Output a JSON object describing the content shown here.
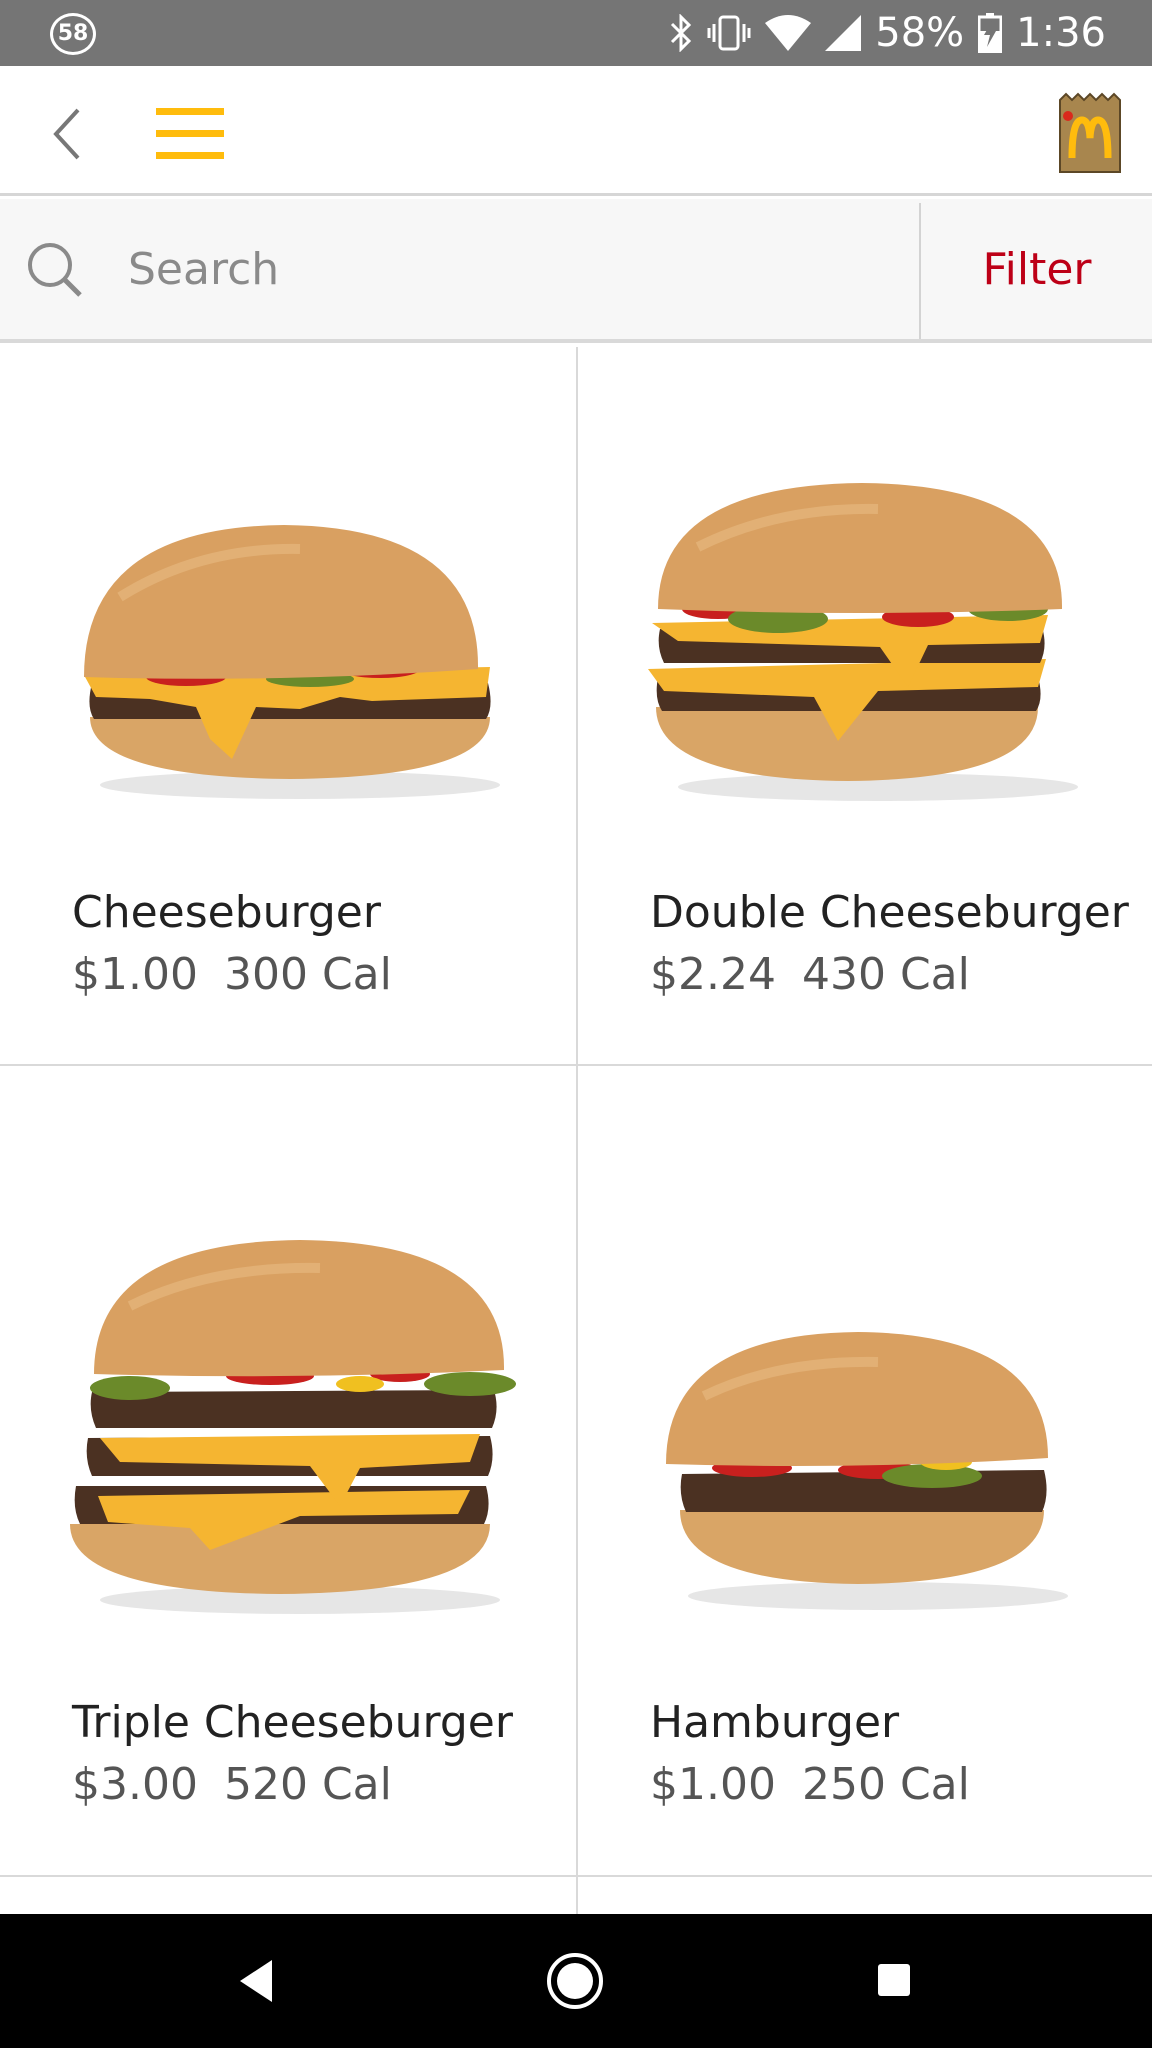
{
  "status_bar": {
    "notification_count": "58",
    "battery_percent": "58%",
    "time": "1:36",
    "icons": [
      "bluetooth-icon",
      "vibrate-icon",
      "wifi-icon",
      "signal-icon",
      "battery-charging-icon"
    ]
  },
  "app_bar": {
    "back_icon": "chevron-left-icon",
    "menu_icon": "hamburger-menu-icon",
    "bag_icon": "mcdonalds-bag-icon",
    "accent_color": "#FFBC0D"
  },
  "search": {
    "placeholder": "Search",
    "value": "",
    "filter_label": "Filter",
    "filter_color": "#BD0017"
  },
  "menu_items": [
    {
      "name": "Cheeseburger",
      "price": "$1.00",
      "calories": "300 Cal",
      "image": "cheeseburger-image"
    },
    {
      "name": "Double Cheeseburger",
      "price": "$2.24",
      "calories": "430 Cal",
      "image": "double-cheeseburger-image"
    },
    {
      "name": "Triple Cheeseburger",
      "price": "$3.00",
      "calories": "520 Cal",
      "image": "triple-cheeseburger-image"
    },
    {
      "name": "Hamburger",
      "price": "$1.00",
      "calories": "250 Cal",
      "image": "hamburger-image"
    }
  ],
  "nav_bar": {
    "icons": [
      "nav-back-icon",
      "nav-home-icon",
      "nav-recents-icon"
    ]
  }
}
